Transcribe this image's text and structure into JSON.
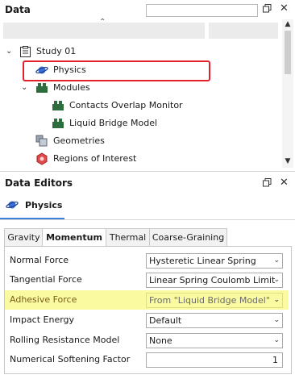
{
  "data_panel": {
    "title": "Data",
    "search": {
      "value": "",
      "placeholder": ""
    },
    "tree": [
      {
        "label": "Study 01",
        "icon": "study-icon",
        "expanded": true
      },
      {
        "label": "Physics",
        "icon": "physics-icon",
        "selected": true
      },
      {
        "label": "Modules",
        "icon": "modules-icon",
        "expanded": true
      },
      {
        "label": "Contacts Overlap Monitor",
        "icon": "module-icon"
      },
      {
        "label": "Liquid Bridge Model",
        "icon": "module-icon"
      },
      {
        "label": "Geometries",
        "icon": "geometries-icon"
      },
      {
        "label": "Regions of Interest",
        "icon": "regions-icon"
      }
    ]
  },
  "editors_panel": {
    "title": "Data Editors",
    "editor_title": "Physics",
    "tabs": [
      "Gravity",
      "Momentum",
      "Thermal",
      "Coarse-Graining"
    ],
    "active_tab": "Momentum",
    "properties": [
      {
        "label": "Normal Force",
        "value": "Hysteretic Linear Spring",
        "type": "dropdown"
      },
      {
        "label": "Tangential Force",
        "value": "Linear Spring Coulomb Limit",
        "type": "dropdown"
      },
      {
        "label": "Adhesive Force",
        "value": "From \"Liquid Bridge Model\"",
        "type": "dropdown",
        "highlighted": true
      },
      {
        "label": "Impact Energy",
        "value": "Default",
        "type": "dropdown"
      },
      {
        "label": "Rolling Resistance Model",
        "value": "None",
        "type": "dropdown"
      },
      {
        "label": "Numerical Softening Factor",
        "value": "1",
        "type": "number"
      }
    ]
  },
  "colors": {
    "selection_outline": "#e0212b",
    "highlight_row": "#fafaa0",
    "module_icon": "#2e6e3e"
  }
}
